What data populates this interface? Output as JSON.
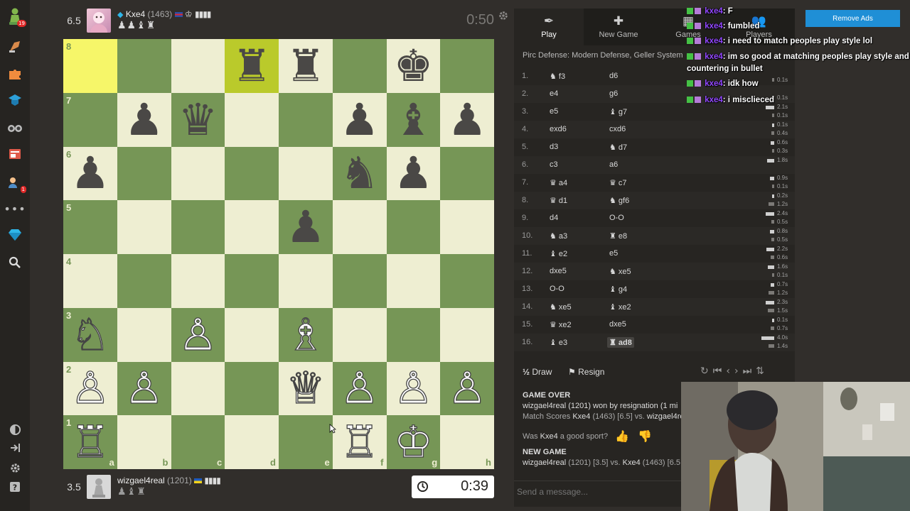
{
  "sidebar": {
    "badges": [
      "19",
      "1"
    ]
  },
  "top_player": {
    "score": "6.5",
    "name": "Kxe4",
    "rating": "(1463)",
    "captured": "♟♟♝♜",
    "clock": "0:50"
  },
  "bottom_player": {
    "score": "3.5",
    "name": "wizgael4real",
    "rating": "(1201)",
    "captured": "♟♝♜",
    "clock": "0:39"
  },
  "board": {
    "ranks": [
      "8",
      "7",
      "6",
      "5",
      "4",
      "3",
      "2",
      "1"
    ],
    "files": [
      "a",
      "b",
      "c",
      "d",
      "e",
      "f",
      "g",
      "h"
    ],
    "highlight": [
      "a8",
      "d8"
    ],
    "pieces": {
      "d8": "♜",
      "e8": "♜",
      "g8": "♚",
      "b7": "♟",
      "c7": "♛",
      "f7": "♟",
      "g7": "♝",
      "h7": "♟",
      "a6": "♟",
      "f6": "♞",
      "g6": "♟",
      "e5": "♟",
      "a3": "♘",
      "c3": "♙",
      "e3": "♗",
      "a2": "♙",
      "b2": "♙",
      "e2": "♕",
      "f2": "♙",
      "g2": "♙",
      "h2": "♙",
      "a1": "♖",
      "f1": "♖",
      "g1": "♔"
    }
  },
  "tabs": [
    {
      "label": "Play",
      "icon": "✒"
    },
    {
      "label": "New Game",
      "icon": "✚"
    },
    {
      "label": "Games",
      "icon": "▦"
    },
    {
      "label": "Players",
      "icon": "👥"
    }
  ],
  "opening": "Pirc Defense: Modern Defense, Geller System",
  "moves": [
    {
      "n": "1.",
      "w": "♞ f3",
      "b": "d6",
      "tw": "",
      "tb": "0.1s",
      "bw": 0,
      "bb": 3
    },
    {
      "n": "2.",
      "w": "e4",
      "b": "g6",
      "tw": "",
      "tb": "0.1s",
      "bw": 0,
      "bb": 3
    },
    {
      "n": "3.",
      "w": "e5",
      "b": "♝ g7",
      "tw": "2.1s",
      "tb": "0.1s",
      "bw": 12,
      "bb": 3
    },
    {
      "n": "4.",
      "w": "exd6",
      "b": "cxd6",
      "tw": "0.1s",
      "tb": "0.4s",
      "bw": 3,
      "bb": 4
    },
    {
      "n": "5.",
      "w": "d3",
      "b": "♞ d7",
      "tw": "0.6s",
      "tb": "0.3s",
      "bw": 5,
      "bb": 3
    },
    {
      "n": "6.",
      "w": "c3",
      "b": "a6",
      "tw": "1.8s",
      "tb": "",
      "bw": 10,
      "bb": 0
    },
    {
      "n": "7.",
      "w": "♛ a4",
      "b": "♛ c7",
      "tw": "0.9s",
      "tb": "0.1s",
      "bw": 6,
      "bb": 3
    },
    {
      "n": "8.",
      "w": "♛ d1",
      "b": "♞ gf6",
      "tw": "0.2s",
      "tb": "1.2s",
      "bw": 3,
      "bb": 8
    },
    {
      "n": "9.",
      "w": "d4",
      "b": "O-O",
      "tw": "2.4s",
      "tb": "0.5s",
      "bw": 12,
      "bb": 4
    },
    {
      "n": "10.",
      "w": "♞ a3",
      "b": "♜ e8",
      "tw": "0.8s",
      "tb": "0.5s",
      "bw": 6,
      "bb": 4
    },
    {
      "n": "11.",
      "w": "♝ e2",
      "b": "e5",
      "tw": "2.2s",
      "tb": "0.6s",
      "bw": 11,
      "bb": 5
    },
    {
      "n": "12.",
      "w": "dxe5",
      "b": "♞ xe5",
      "tw": "1.6s",
      "tb": "0.1s",
      "bw": 9,
      "bb": 3
    },
    {
      "n": "13.",
      "w": "O-O",
      "b": "♝ g4",
      "tw": "0.7s",
      "tb": "1.2s",
      "bw": 5,
      "bb": 8
    },
    {
      "n": "14.",
      "w": "♞ xe5",
      "b": "♝ xe2",
      "tw": "2.3s",
      "tb": "1.5s",
      "bw": 12,
      "bb": 9
    },
    {
      "n": "15.",
      "w": "♛ xe2",
      "b": "dxe5",
      "tw": "0.1s",
      "tb": "0.7s",
      "bw": 3,
      "bb": 5
    },
    {
      "n": "16.",
      "w": "♝ e3",
      "b": "♜ ad8",
      "tw": "4.0s",
      "tb": "1.4s",
      "bw": 18,
      "bb": 8
    }
  ],
  "actions": {
    "draw": "Draw",
    "resign": "Resign"
  },
  "chatlog": {
    "game_over": "GAME OVER",
    "result": "wizgael4real (1201) won by resignation (1 mi",
    "match_scores_prefix": "Match Scores",
    "match_scores_p1": "Kxe4",
    "match_scores_mid": "(1463) [6.5] vs.",
    "match_scores_p2": "wizgael4re",
    "sport_prefix": "Was",
    "sport_name": "Kxe4",
    "sport_suffix": "a good sport?",
    "new_game": "NEW GAME",
    "new_game_p1": "wizgael4real",
    "new_game_mid": "(1201) [3.5] vs.",
    "new_game_p2": "Kxe4",
    "new_game_tail": "(1463) [6.5"
  },
  "message_placeholder": "Send a message...",
  "stream_chat": [
    {
      "user": "kxe4",
      "text": ": F"
    },
    {
      "user": "kxe4",
      "text": ": fumbled"
    },
    {
      "user": "kxe4",
      "text": ": i need to match peoples play style lol"
    },
    {
      "user": "kxe4",
      "text": ": im so good at matching peoples play style and"
    },
    {
      "user": "",
      "text": "countering in bullet"
    },
    {
      "user": "kxe4",
      "text": ": idk how"
    },
    {
      "user": "kxe4",
      "text": ": i misclieced"
    }
  ],
  "remove_ads": "Remove Ads",
  "colors": {
    "board_light": "#eeeed2",
    "board_dark": "#769656",
    "highlight": "#f6f669",
    "twitch_purple": "#9146ff",
    "ads_blue": "#1f8fd6"
  }
}
